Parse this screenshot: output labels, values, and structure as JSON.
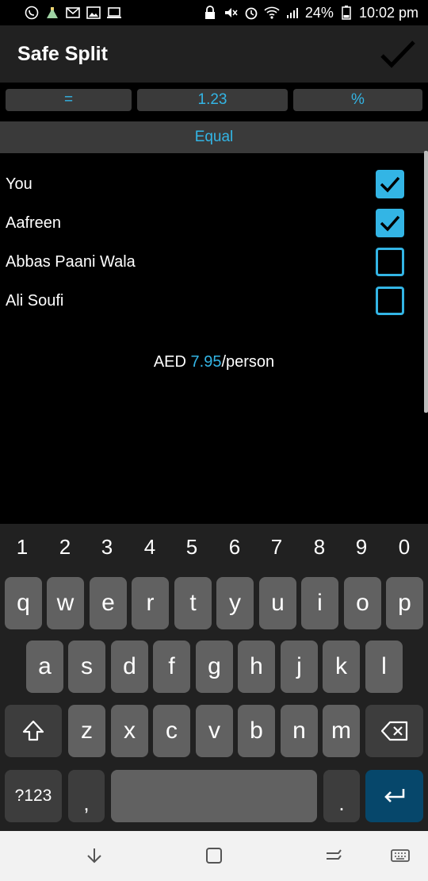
{
  "status_bar": {
    "battery": "24%",
    "time": "10:02 pm",
    "left_icons": [
      "whatsapp-icon",
      "flask-icon",
      "gmail-icon",
      "image-icon",
      "laptop-icon"
    ],
    "right_icons": [
      "lock-icon",
      "mute-icon",
      "alarm-icon",
      "wifi-icon",
      "signal-icon",
      "battery-icon"
    ]
  },
  "app_bar": {
    "title": "Safe Split",
    "confirm_icon": "check-icon"
  },
  "split_modes": {
    "equals": "=",
    "value": "1.23",
    "percent": "%"
  },
  "mode_label": "Equal",
  "people": [
    {
      "name": "You",
      "checked": true
    },
    {
      "name": "Aafreen",
      "checked": true
    },
    {
      "name": "Abbas Paani Wala",
      "checked": false
    },
    {
      "name": "Ali Soufi",
      "checked": false
    }
  ],
  "per_person": {
    "currency": "AED",
    "amount": "7.95",
    "suffix": "/person"
  },
  "keyboard": {
    "numbers": [
      "1",
      "2",
      "3",
      "4",
      "5",
      "6",
      "7",
      "8",
      "9",
      "0"
    ],
    "row1": [
      "q",
      "w",
      "e",
      "r",
      "t",
      "y",
      "u",
      "i",
      "o",
      "p"
    ],
    "row2": [
      "a",
      "s",
      "d",
      "f",
      "g",
      "h",
      "j",
      "k",
      "l"
    ],
    "row3": [
      "z",
      "x",
      "c",
      "v",
      "b",
      "n",
      "m"
    ],
    "symbols_label": "?123",
    "comma": ",",
    "period": "."
  },
  "colors": {
    "accent": "#33b5e5",
    "key": "#616161",
    "key_dark": "#3d3d3d",
    "enter": "#06476b"
  },
  "nav_bar": {
    "icons": [
      "hide-keyboard-icon",
      "home-icon",
      "recents-icon",
      "keyboard-icon"
    ]
  }
}
